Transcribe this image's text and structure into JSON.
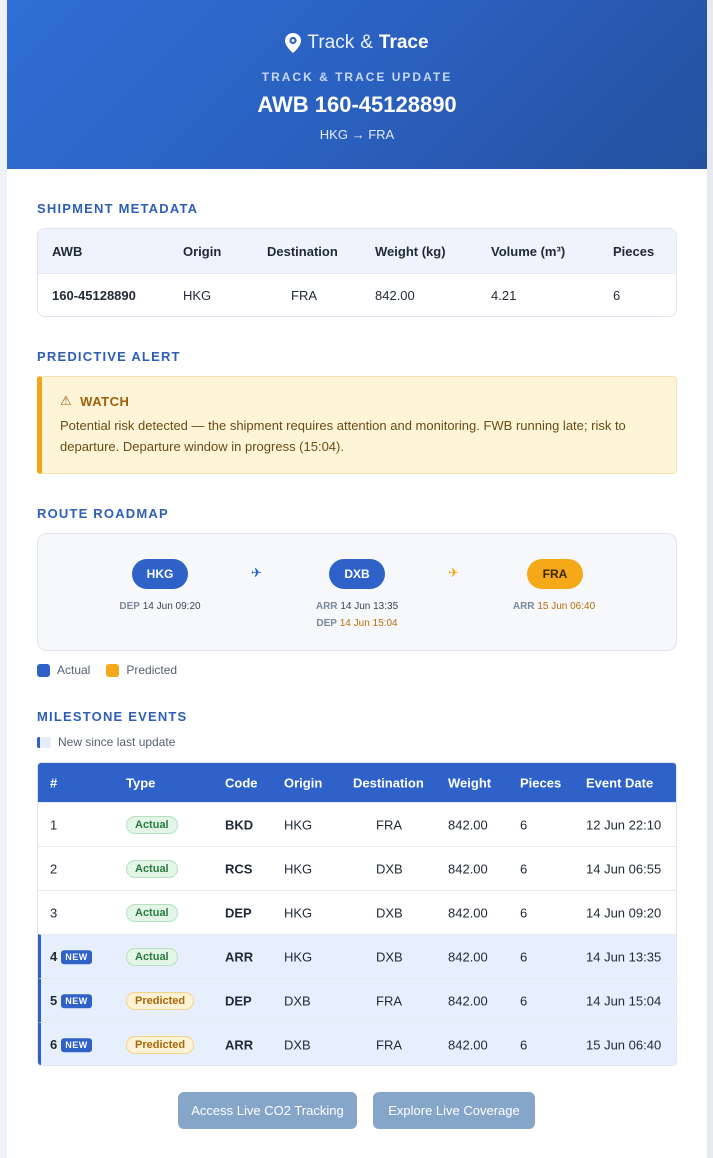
{
  "brand": {
    "word1": "Track",
    "amp": "&",
    "word2": "Trace"
  },
  "header": {
    "eyebrow": "TRACK & TRACE UPDATE",
    "awb_title": "AWB 160-45128890",
    "route": "HKG → FRA"
  },
  "metadata": {
    "section_title": "SHIPMENT METADATA",
    "columns": [
      "AWB",
      "Origin",
      "Destination",
      "Weight (kg)",
      "Volume (m³)",
      "Pieces"
    ],
    "row": {
      "awb": "160-45128890",
      "origin": "HKG",
      "destination": "FRA",
      "weight": "842.00",
      "volume": "4.21",
      "pieces": "6"
    }
  },
  "alert": {
    "section_title": "PREDICTIVE ALERT",
    "level": "WATCH",
    "message": "Potential risk detected — the shipment requires attention and monitoring. FWB running late; risk to departure. Departure window in progress (15:04)."
  },
  "roadmap": {
    "section_title": "ROUTE ROADMAP",
    "stops": [
      {
        "code": "HKG",
        "kind": "actual",
        "line1_label": "DEP",
        "line1_value": "14 Jun 09:20",
        "line1_kind": "actual"
      },
      {
        "code": "DXB",
        "kind": "actual",
        "line1_label": "ARR",
        "line1_value": "14 Jun 13:35",
        "line1_kind": "actual",
        "line2_label": "DEP",
        "line2_value": "14 Jun 15:04",
        "line2_kind": "predicted"
      },
      {
        "code": "FRA",
        "kind": "predicted",
        "line1_label": "ARR",
        "line1_value": "15 Jun 06:40",
        "line1_kind": "predicted"
      }
    ],
    "legend": {
      "actual": "Actual",
      "predicted": "Predicted"
    }
  },
  "events": {
    "section_title": "MILESTONE EVENTS",
    "new_legend": "New since last update",
    "new_tag": "NEW",
    "columns": [
      "#",
      "Type",
      "Code",
      "Origin",
      "Destination",
      "Weight",
      "Pieces",
      "Event Date"
    ],
    "rows": [
      {
        "num": "1",
        "type": "Actual",
        "code": "BKD",
        "origin": "HKG",
        "destination": "FRA",
        "weight": "842.00",
        "pieces": "6",
        "date": "12 Jun 22:10",
        "is_new": false
      },
      {
        "num": "2",
        "type": "Actual",
        "code": "RCS",
        "origin": "HKG",
        "destination": "DXB",
        "weight": "842.00",
        "pieces": "6",
        "date": "14 Jun 06:55",
        "is_new": false
      },
      {
        "num": "3",
        "type": "Actual",
        "code": "DEP",
        "origin": "HKG",
        "destination": "DXB",
        "weight": "842.00",
        "pieces": "6",
        "date": "14 Jun 09:20",
        "is_new": false
      },
      {
        "num": "4",
        "type": "Actual",
        "code": "ARR",
        "origin": "HKG",
        "destination": "DXB",
        "weight": "842.00",
        "pieces": "6",
        "date": "14 Jun 13:35",
        "is_new": true
      },
      {
        "num": "5",
        "type": "Predicted",
        "code": "DEP",
        "origin": "DXB",
        "destination": "FRA",
        "weight": "842.00",
        "pieces": "6",
        "date": "14 Jun 15:04",
        "is_new": true
      },
      {
        "num": "6",
        "type": "Predicted",
        "code": "ARR",
        "origin": "DXB",
        "destination": "FRA",
        "weight": "842.00",
        "pieces": "6",
        "date": "15 Jun 06:40",
        "is_new": true
      }
    ]
  },
  "actions": {
    "co2": "Access Live CO2 Tracking",
    "coverage": "Explore Live Coverage"
  },
  "colors": {
    "primary": "#2f62c9",
    "predicted": "#f5a818",
    "actual_badge": "#2a7a3e",
    "alert_accent": "#f0a51b"
  },
  "icons": {
    "brand": "location-pin-icon",
    "alert": "warning-icon",
    "transit": "airplane-icon"
  }
}
